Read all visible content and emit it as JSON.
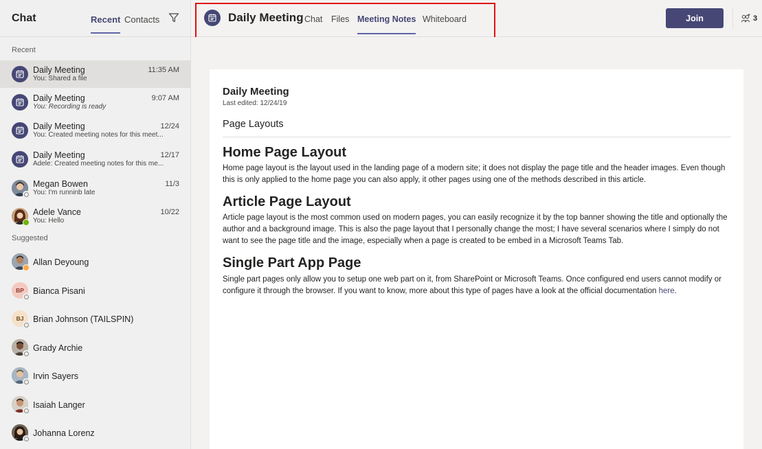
{
  "left_pane": {
    "title": "Chat",
    "tabs": [
      {
        "label": "Recent",
        "active": true
      },
      {
        "label": "Contacts",
        "active": false
      }
    ],
    "recent_label": "Recent",
    "suggested_label": "Suggested",
    "recent": [
      {
        "name": "Daily Meeting",
        "preview": "You: Shared a file",
        "time": "11:35 AM",
        "type": "meeting",
        "selected": true,
        "italic": false
      },
      {
        "name": "Daily Meeting",
        "preview": "You: Recording is ready",
        "time": "9:07 AM",
        "type": "meeting",
        "selected": false,
        "italic": true
      },
      {
        "name": "Daily Meeting",
        "preview": "You: Created meeting notes for this meet...",
        "time": "12/24",
        "type": "meeting",
        "selected": false,
        "italic": false
      },
      {
        "name": "Daily Meeting",
        "preview": "Adele: Created meeting notes for this me...",
        "time": "12/17",
        "type": "meeting",
        "selected": false,
        "italic": false
      },
      {
        "name": "Megan Bowen",
        "preview": "You: I'm runninb late",
        "time": "11/3",
        "type": "photo",
        "presence": "offline",
        "selected": false,
        "italic": false
      },
      {
        "name": "Adele Vance",
        "preview": "You: Hello",
        "time": "10/22",
        "type": "photo",
        "presence": "available",
        "selected": false,
        "italic": false
      }
    ],
    "suggested": [
      {
        "name": "Allan Deyoung",
        "type": "photo",
        "presence": "away"
      },
      {
        "name": "Bianca Pisani",
        "type": "initials",
        "initials": "BP",
        "presence": "offline"
      },
      {
        "name": "Brian Johnson (TAILSPIN)",
        "type": "initials",
        "initials": "BJ",
        "presence": "offline"
      },
      {
        "name": "Grady Archie",
        "type": "photo",
        "presence": "offline"
      },
      {
        "name": "Irvin Sayers",
        "type": "photo",
        "presence": "offline"
      },
      {
        "name": "Isaiah Langer",
        "type": "photo",
        "presence": "offline"
      },
      {
        "name": "Johanna Lorenz",
        "type": "photo",
        "presence": "offline"
      }
    ]
  },
  "header": {
    "meeting_title": "Daily Meeting",
    "tabs": [
      {
        "label": "Chat",
        "active": false
      },
      {
        "label": "Files",
        "active": false
      },
      {
        "label": "Meeting Notes",
        "active": true
      },
      {
        "label": "Whiteboard",
        "active": false
      }
    ],
    "join_label": "Join",
    "participant_count": "3",
    "icons": {
      "meeting": "calendar-icon",
      "filter": "filter-icon",
      "people": "people-add-icon"
    }
  },
  "document": {
    "title": "Daily Meeting",
    "last_edited": "Last edited: 12/24/19",
    "section": "Page Layouts",
    "blocks": [
      {
        "heading": "Home Page Layout",
        "body": "Home page layout is the layout used in the landing page of a modern site; it does not display the page title and the header images. Even though this is only applied to the home page you can also apply, it other pages using one of the methods described in this article."
      },
      {
        "heading": "Article Page Layout",
        "body": "Article page layout is the most common used on modern pages, you can easily recognize it by the top banner showing the title and optionally the author and a background image. This is also the page layout that I personally change the most; I have several scenarios where I simply do not want to see the page title and the image, especially when a page is created to be embed in a Microsoft Teams Tab."
      },
      {
        "heading": "Single Part App Page",
        "body": "Single part pages only allow you to setup one web part on it, from SharePoint or Microsoft Teams. Once configured end users cannot modify or configure it through the browser. If you want to know, more about this type of pages have a look at the official documentation ",
        "link": "here",
        "after_link": "."
      }
    ]
  },
  "colors": {
    "accent": "#464775",
    "accent_light": "#6264a7",
    "highlight": "#e01010",
    "available": "#6bb700",
    "away": "#ffaa44"
  }
}
